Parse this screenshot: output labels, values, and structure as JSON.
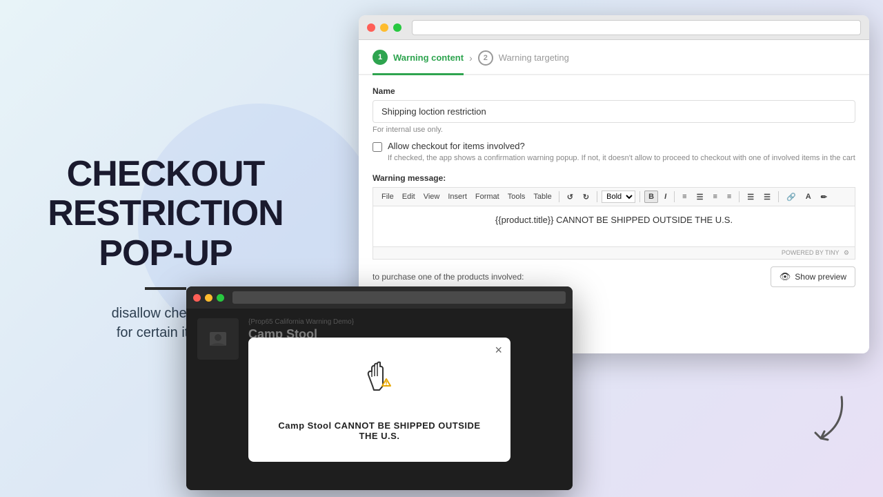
{
  "left": {
    "title_line1": "CHECKOUT",
    "title_line2": "RESTRICTION",
    "title_line3": "POP-UP",
    "subtitle": "disallow checkout\nfor certain items"
  },
  "browser": {
    "step1": {
      "number": "1",
      "label": "Warning content"
    },
    "step2": {
      "number": "2",
      "label": "Warning targeting"
    },
    "form": {
      "name_label": "Name",
      "name_value": "Shipping loction restriction",
      "hint": "For internal use only.",
      "checkbox_label": "Allow checkout for items involved?",
      "checkbox_desc": "If checked, the app shows a confirmation warning popup. If not, it doesn't allow to proceed to checkout with one of involved items in the cart",
      "warning_msg_label": "Warning message:",
      "toolbar_menus": [
        "File",
        "Edit",
        "View",
        "Insert",
        "Format",
        "Tools",
        "Table"
      ],
      "toolbar_font": "Bold",
      "editor_content": "{{product.title}} CANNOT BE SHIPPED OUTSIDE THE U.S.",
      "powered_by": "POWERED BY TINY",
      "purchase_text": "to purchase one of the products involved:",
      "show_preview_btn": "Show preview"
    }
  },
  "preview": {
    "store_name": "{Prop65 California Warning Demo}",
    "product_name": "Camp Stool",
    "modal": {
      "message": "Camp Stool CANNOT BE SHIPPED OUTSIDE THE U.S.",
      "close": "×"
    }
  }
}
